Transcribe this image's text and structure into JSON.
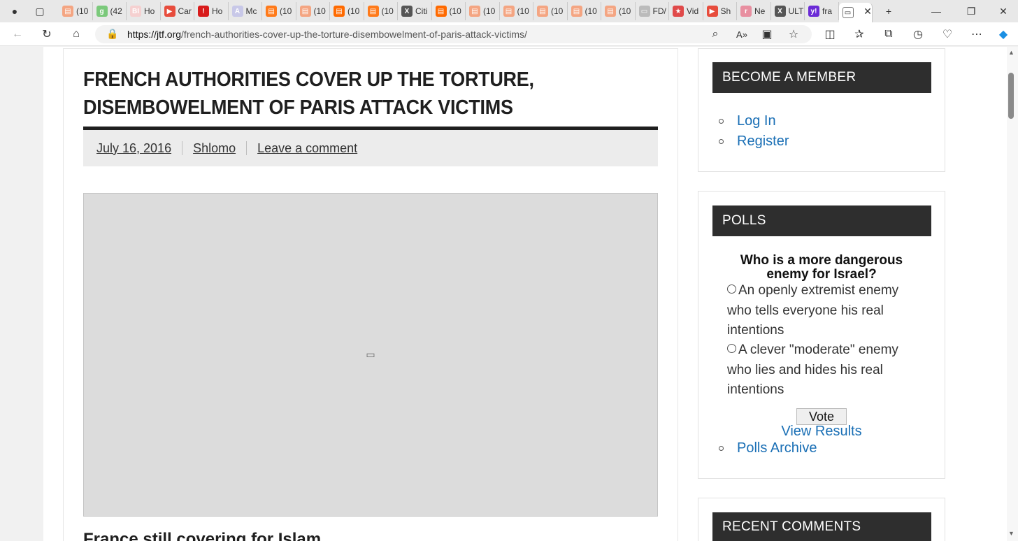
{
  "browser": {
    "tabs": [
      {
        "title": "(10",
        "color": "#f4a582",
        "glyph": "▤"
      },
      {
        "title": "(42",
        "color": "#7bc97b",
        "glyph": "g"
      },
      {
        "title": "Ho",
        "color": "#f5d0d0",
        "glyph": "BI"
      },
      {
        "title": "Car",
        "color": "#e74c3c",
        "glyph": "▶"
      },
      {
        "title": "Ho",
        "color": "#d81b1b",
        "glyph": "!"
      },
      {
        "title": "Mc",
        "color": "#c8c8e8",
        "glyph": "A"
      },
      {
        "title": "(10",
        "color": "#ff7a1a",
        "glyph": "▤"
      },
      {
        "title": "(10",
        "color": "#f4a582",
        "glyph": "▤"
      },
      {
        "title": "(10",
        "color": "#ff6a00",
        "glyph": "▤"
      },
      {
        "title": "(10",
        "color": "#ff7a1a",
        "glyph": "▤"
      },
      {
        "title": "Citi",
        "color": "#555555",
        "glyph": "X"
      },
      {
        "title": "(10",
        "color": "#ff6a00",
        "glyph": "▤"
      },
      {
        "title": "(10",
        "color": "#f4a582",
        "glyph": "▤"
      },
      {
        "title": "(10",
        "color": "#f4a582",
        "glyph": "▤"
      },
      {
        "title": "(10",
        "color": "#f4a582",
        "glyph": "▤"
      },
      {
        "title": "(10",
        "color": "#f4a582",
        "glyph": "▤"
      },
      {
        "title": "(10",
        "color": "#f4a582",
        "glyph": "▤"
      },
      {
        "title": "FD/",
        "color": "#bbbbbb",
        "glyph": "▭"
      },
      {
        "title": "Vid",
        "color": "#e04a4a",
        "glyph": "★"
      },
      {
        "title": "Sh",
        "color": "#e74c3c",
        "glyph": "▶"
      },
      {
        "title": "Ne",
        "color": "#e88fa0",
        "glyph": "r"
      },
      {
        "title": "ULT",
        "color": "#555555",
        "glyph": "X"
      },
      {
        "title": "fra",
        "color": "#6b2bd6",
        "glyph": "y!"
      },
      {
        "title": "",
        "color": "#ffffff",
        "glyph": "▭"
      }
    ],
    "url_host": "https://jtf.org",
    "url_path": "/french-authorities-cover-up-the-torture-disembowelment-of-paris-attack-victims/"
  },
  "article": {
    "title": "French Authorities Cover Up The Torture, Disembowelment Of Paris Attack Victims",
    "date": "July 16, 2016",
    "author": "Shlomo",
    "comment_link": "Leave a comment",
    "subheading": "France still covering for Islam"
  },
  "sidebar": {
    "member": {
      "title": "Become A Member",
      "links": [
        "Log In",
        "Register"
      ]
    },
    "polls": {
      "title": "Polls",
      "question": "Who is a more dangerous enemy for Israel?",
      "options": [
        "An openly extremist enemy who tells everyone his real intentions",
        "A clever \"moderate\" enemy who lies and hides his real intentions"
      ],
      "vote_label": "Vote",
      "results_label": "View Results",
      "archive_label": "Polls Archive"
    },
    "recent": {
      "title": "Recent Comments"
    }
  }
}
